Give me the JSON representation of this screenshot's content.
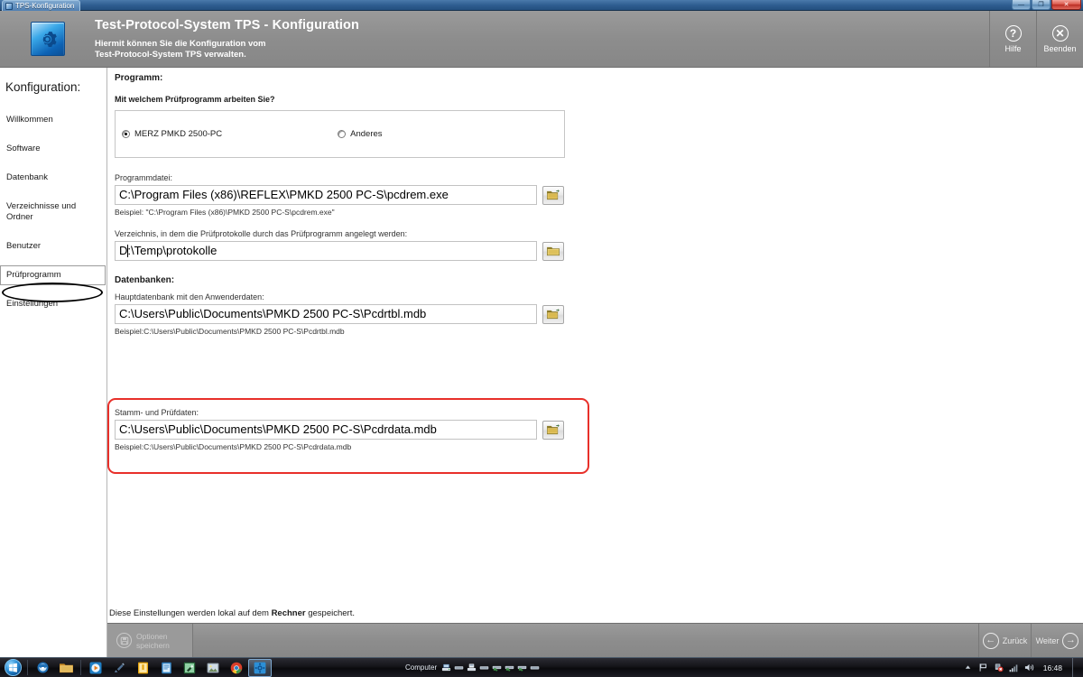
{
  "window": {
    "taskbar_tab_title": "TPS-Konfiguration",
    "minimize_glyph": "—",
    "maximize_glyph": "❐",
    "close_glyph": "✕"
  },
  "header": {
    "app_icon": "gear-icon",
    "title": "Test-Protocol-System TPS - Konfiguration",
    "subtitle_line1": "Hiermit können Sie die Konfiguration vom",
    "subtitle_line2": "Test-Protocol-System TPS verwalten.",
    "buttons": [
      {
        "label": "Hilfe",
        "glyph": "?",
        "icon": "help-icon"
      },
      {
        "label": "Beenden",
        "glyph": "✕",
        "icon": "close-circle-icon"
      }
    ]
  },
  "sidebar": {
    "title": "Konfiguration:",
    "items": [
      {
        "label": "Willkommen",
        "selected": false
      },
      {
        "label": "Software",
        "selected": false
      },
      {
        "label": "Datenbank",
        "selected": false
      },
      {
        "label": "Verzeichnisse und Ordner",
        "selected": false
      },
      {
        "label": "Benutzer",
        "selected": false
      },
      {
        "label": "Prüfprogramm",
        "selected": true
      },
      {
        "label": "Einstellungen",
        "selected": false
      }
    ]
  },
  "main": {
    "program_section_title": "Programm:",
    "program_question": "Mit welchem Prüfprogramm arbeiten Sie?",
    "program_options": [
      {
        "label": "MERZ PMKD 2500-PC",
        "checked": true
      },
      {
        "label": "Anderes",
        "checked": false
      }
    ],
    "program_file": {
      "label": "Programmdatei:",
      "value": "C:\\Program Files (x86)\\REFLEX\\PMKD 2500 PC-S\\pcdrem.exe",
      "hint": "Beispiel: \"C:\\Program Files (x86)\\PMKD 2500 PC-S\\pcdrem.exe\"",
      "browse_icon": "open-file-folder-icon"
    },
    "protocol_dir": {
      "label": "Verzeichnis, in dem die Prüfprotokolle durch das Prüfprogramm angelegt werden:",
      "value": "D:\\Temp\\protokolle",
      "value_before_caret": "D",
      "value_after_caret": ":\\Temp\\protokolle",
      "browse_icon": "folder-icon"
    },
    "databases_section_title": "Datenbanken:",
    "main_database": {
      "label": "Hauptdatenbank mit den Anwenderdaten:",
      "value": "C:\\Users\\Public\\Documents\\PMKD 2500 PC-S\\Pcdrtbl.mdb",
      "hint": "Beispiel:C:\\Users\\Public\\Documents\\PMKD 2500 PC-S\\Pcdrtbl.mdb",
      "browse_icon": "open-file-folder-icon"
    },
    "master_test_data": {
      "label": "Stamm- und Prüfdaten:",
      "value": "C:\\Users\\Public\\Documents\\PMKD 2500 PC-S\\Pcdrdata.mdb",
      "hint": "Beispiel:C:\\Users\\Public\\Documents\\PMKD 2500 PC-S\\Pcdrdata.mdb",
      "browse_icon": "open-file-folder-icon",
      "highlight_color": "#e8302a"
    }
  },
  "footer": {
    "note_prefix": "Diese Einstellungen werden lokal auf dem ",
    "note_bold": "Rechner",
    "note_suffix": " gespeichert.",
    "save_label_line1": "Optionen",
    "save_label_line2": "speichern",
    "save_icon": "floppy-disk-icon",
    "back_label": "Zurück",
    "back_icon": "arrow-left-icon",
    "next_label": "Weiter",
    "next_icon": "arrow-right-icon"
  },
  "taskbar": {
    "start_icon": "windows-start-icon",
    "pinned": [
      {
        "icon": "internet-explorer-icon",
        "active": false
      },
      {
        "icon": "file-explorer-icon",
        "active": false
      }
    ],
    "running": [
      {
        "icon": "media-player-icon",
        "active": false
      },
      {
        "icon": "paint-tool-icon",
        "active": false
      },
      {
        "icon": "notepad-app-icon",
        "active": false
      },
      {
        "icon": "document-app-icon",
        "active": false
      },
      {
        "icon": "editor-app-icon",
        "active": false
      },
      {
        "icon": "image-viewer-icon",
        "active": false
      },
      {
        "icon": "chrome-icon",
        "active": false
      },
      {
        "icon": "tps-konfiguration-icon",
        "active": true
      }
    ],
    "computer_toolbar_label": "Computer",
    "computer_drive_count": 8,
    "tray": [
      {
        "icon": "show-hidden-icons-icon"
      },
      {
        "icon": "flag-action-center-icon"
      },
      {
        "icon": "network-error-icon"
      },
      {
        "icon": "signal-strength-icon"
      },
      {
        "icon": "volume-icon"
      }
    ],
    "clock": "16:48"
  },
  "colors": {
    "header_gray": "#8d8d8d",
    "highlight_red": "#e8302a",
    "taskbar_dark": "#141418",
    "accent_blue": "#2c8fd6"
  }
}
